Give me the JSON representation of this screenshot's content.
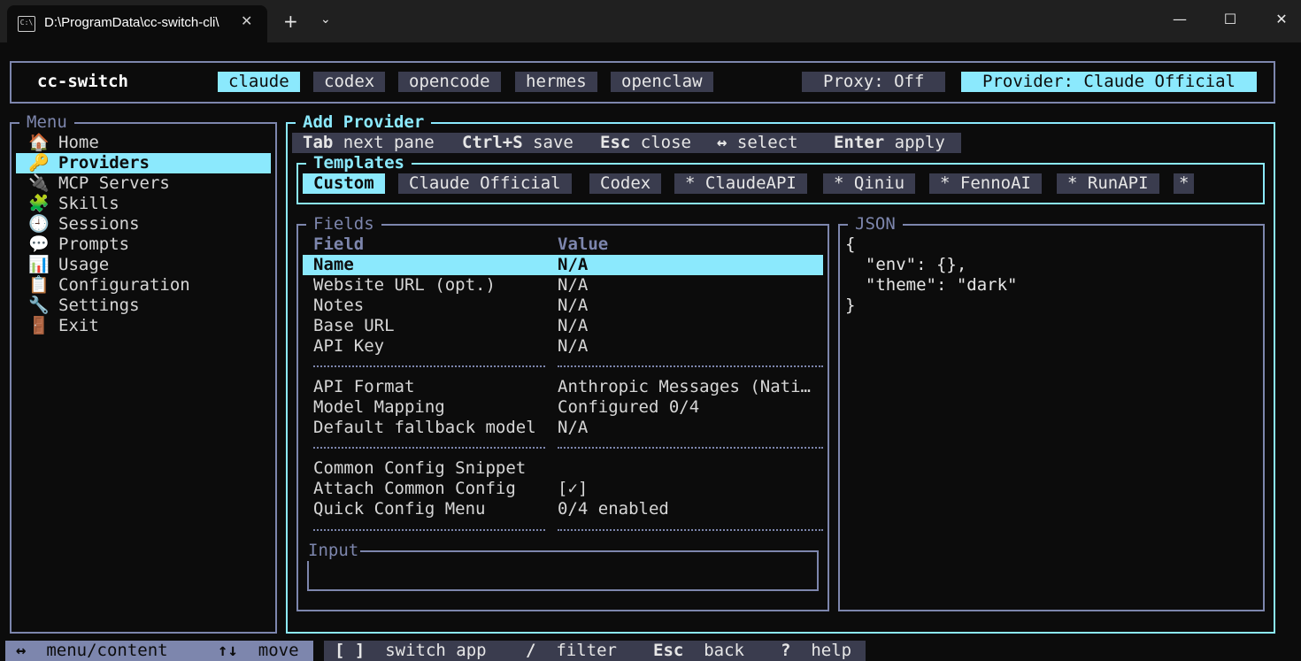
{
  "window": {
    "tab_title": "D:\\ProgramData\\cc-switch-cli\\",
    "tab_close": "✕",
    "new_tab": "+",
    "tab_dropdown": "⌄",
    "minimize": "—",
    "maximize": "☐",
    "close": "✕",
    "tab_icon_text": "C:\\"
  },
  "header": {
    "app_name": "cc-switch",
    "apps": [
      "claude",
      "codex",
      "opencode",
      "hermes",
      "openclaw"
    ],
    "active_app": "claude",
    "proxy": "Proxy: Off",
    "provider": "Provider: Claude Official"
  },
  "menu": {
    "title": "Menu",
    "items": [
      {
        "icon": "🏠",
        "icon_name": "home-icon",
        "label": "Home"
      },
      {
        "icon": "🔑",
        "icon_name": "key-icon",
        "label": "Providers"
      },
      {
        "icon": "🔌",
        "icon_name": "plug-icon",
        "label": "MCP Servers"
      },
      {
        "icon": "🧩",
        "icon_name": "puzzle-icon",
        "label": "Skills"
      },
      {
        "icon": "🕘",
        "icon_name": "clock-icon",
        "label": "Sessions"
      },
      {
        "icon": "💬",
        "icon_name": "speech-bubble-icon",
        "label": "Prompts"
      },
      {
        "icon": "📊",
        "icon_name": "bar-chart-icon",
        "label": "Usage"
      },
      {
        "icon": "📋",
        "icon_name": "clipboard-icon",
        "label": "Configuration"
      },
      {
        "icon": "🔧",
        "icon_name": "wrench-icon",
        "label": "Settings"
      },
      {
        "icon": "🚪",
        "icon_name": "door-icon",
        "label": "Exit"
      }
    ],
    "selected": "Providers"
  },
  "content": {
    "title": "Add Provider",
    "hints": [
      {
        "key": "Tab",
        "desc": "next pane"
      },
      {
        "key": "Ctrl+S",
        "desc": "save"
      },
      {
        "key": "Esc",
        "desc": "close"
      },
      {
        "key": "↔",
        "desc": "select"
      },
      {
        "key": "Enter",
        "desc": "apply"
      }
    ],
    "templates": {
      "title": "Templates",
      "items": [
        "Custom",
        "Claude Official",
        "Codex",
        "* ClaudeAPI",
        "* Qiniu",
        "* FennoAI",
        "* RunAPI",
        "*"
      ],
      "active": "Custom"
    },
    "fields": {
      "title": "Fields",
      "col_field": "Field",
      "col_value": "Value",
      "groups": [
        [
          {
            "field": "Name",
            "value": "N/A"
          },
          {
            "field": "Website URL (opt.)",
            "value": "N/A"
          },
          {
            "field": "Notes",
            "value": "N/A"
          },
          {
            "field": "Base URL",
            "value": "N/A"
          },
          {
            "field": "API Key",
            "value": "N/A"
          }
        ],
        [
          {
            "field": "API Format",
            "value": "Anthropic Messages (Nati…"
          },
          {
            "field": "Model Mapping",
            "value": "Configured 0/4"
          },
          {
            "field": "Default fallback model",
            "value": "N/A"
          }
        ],
        [
          {
            "field": "Common Config Snippet",
            "value": ""
          },
          {
            "field": "Attach Common Config",
            "value": "[✓]"
          },
          {
            "field": "Quick Config Menu",
            "value": "0/4 enabled"
          }
        ]
      ],
      "selected": "Name"
    },
    "input": {
      "title": "Input",
      "value": ""
    },
    "json": {
      "title": "JSON",
      "lines": [
        "{",
        "  \"env\": {},",
        "  \"theme\": \"dark\"",
        "}"
      ]
    }
  },
  "statusbar": {
    "nav": [
      {
        "key": "↔",
        "desc": "menu/content"
      },
      {
        "key": "↑↓",
        "desc": "move"
      }
    ],
    "actions": [
      {
        "key": "[ ]",
        "desc": "switch app"
      },
      {
        "key": "/",
        "desc": "filter"
      },
      {
        "key": "Esc",
        "desc": "back"
      },
      {
        "key": "?",
        "desc": "help"
      }
    ]
  },
  "colors": {
    "accent": "#8be9fd",
    "border": "#7d86ad",
    "chip": "#3a3c4e",
    "background": "#0c0c0c"
  }
}
